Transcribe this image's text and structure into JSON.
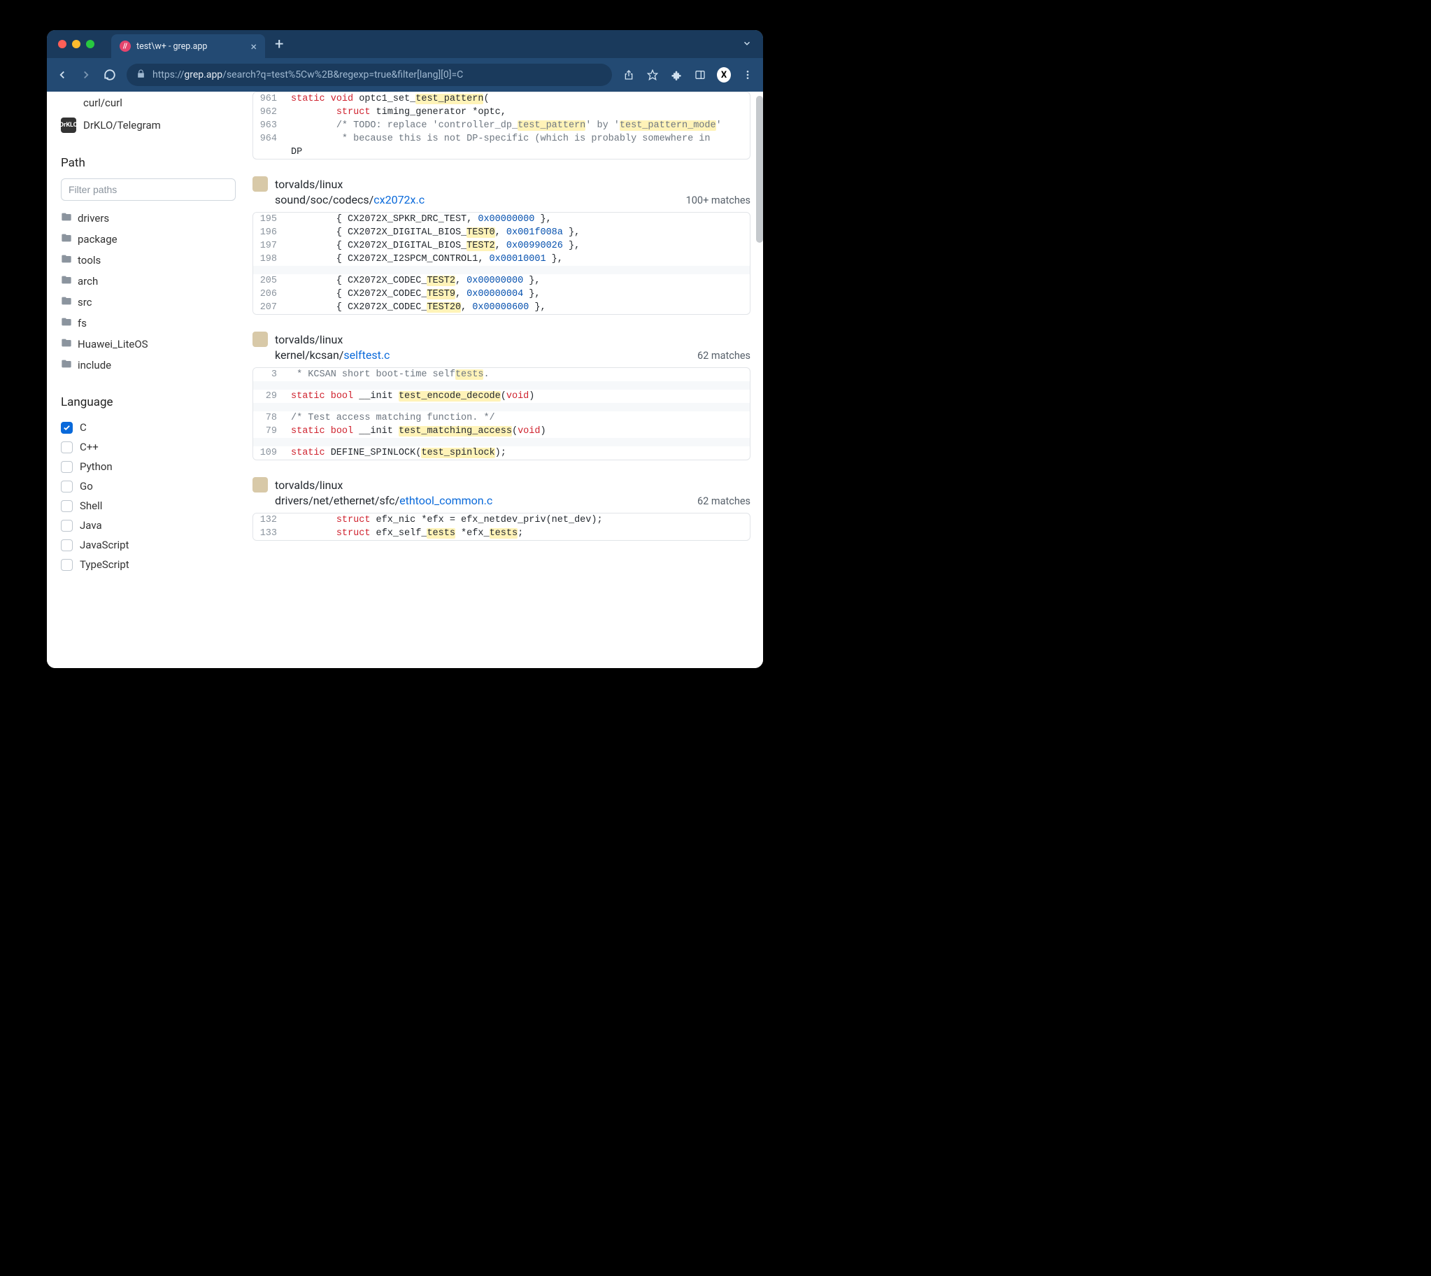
{
  "browser": {
    "tab_title": "test\\w+ - grep.app",
    "url_proto_host": "grep.app",
    "url_scheme": "https://",
    "url_path": "/search?q=test%5Cw%2B&regexp=true&filter[lang][0]=C"
  },
  "sidebar": {
    "repos": [
      {
        "name": "curl/curl",
        "avatar": ""
      },
      {
        "name": "DrKLO/Telegram",
        "avatar": "DrKLO"
      }
    ],
    "path_label": "Path",
    "path_placeholder": "Filter paths",
    "paths": [
      "drivers",
      "package",
      "tools",
      "arch",
      "src",
      "fs",
      "Huawei_LiteOS",
      "include"
    ],
    "lang_label": "Language",
    "languages": [
      {
        "name": "C",
        "checked": true
      },
      {
        "name": "C++",
        "checked": false
      },
      {
        "name": "Python",
        "checked": false
      },
      {
        "name": "Go",
        "checked": false
      },
      {
        "name": "Shell",
        "checked": false
      },
      {
        "name": "Java",
        "checked": false
      },
      {
        "name": "JavaScript",
        "checked": false
      },
      {
        "name": "TypeScript",
        "checked": false
      }
    ]
  },
  "results": [
    {
      "repo": "",
      "path_prefix": "",
      "path_link": "",
      "matches": "",
      "lines": [
        {
          "no": "961",
          "code": "<span class='kw'>static</span> <span class='kw'>void</span> optc1_set_<span class='hl'>test_pattern</span>("
        },
        {
          "no": "962",
          "code": "        <span class='kw'>struct</span> timing_generator *optc,"
        },
        {
          "no": "963",
          "code": "        <span class='com'>/* TODO: replace 'controller_dp_<span class='hl'>test_pattern</span>' by '<span class='hl'>test_pattern_mode</span>'</span>"
        },
        {
          "no": "964",
          "code": "        <span class='com'> * because this is not DP-specific (which is probably somewhere in</span>"
        }
      ],
      "cont": "DP"
    },
    {
      "repo": "torvalds/linux",
      "path_prefix": "sound/soc/codecs/",
      "path_link": "cx2072x.c",
      "matches": "100+ matches",
      "lines": [
        {
          "no": "195",
          "code": "        { CX2072X_SPKR_DRC_TEST, <span class='num'>0x00000000</span> },"
        },
        {
          "no": "196",
          "code": "        { CX2072X_DIGITAL_BIOS_<span class='hl'>TEST0</span>, <span class='num'>0x001f008a</span> },"
        },
        {
          "no": "197",
          "code": "        { CX2072X_DIGITAL_BIOS_<span class='hl'>TEST2</span>, <span class='num'>0x00990026</span> },"
        },
        {
          "no": "198",
          "code": "        { CX2072X_I2SPCM_CONTROL1, <span class='num'>0x00010001</span> },"
        }
      ],
      "lines2": [
        {
          "no": "205",
          "code": "        { CX2072X_CODEC_<span class='hl'>TEST2</span>, <span class='num'>0x00000000</span> },"
        },
        {
          "no": "206",
          "code": "        { CX2072X_CODEC_<span class='hl'>TEST9</span>, <span class='num'>0x00000004</span> },"
        },
        {
          "no": "207",
          "code": "        { CX2072X_CODEC_<span class='hl'>TEST20</span>, <span class='num'>0x00000600</span> },"
        }
      ]
    },
    {
      "repo": "torvalds/linux",
      "path_prefix": "kernel/kcsan/",
      "path_link": "selftest.c",
      "matches": "62 matches",
      "lines": [
        {
          "no": "3",
          "code": "<span class='com'> * KCSAN short boot-time self<span class='hl'>tests</span>.</span>"
        }
      ],
      "lines2": [
        {
          "no": "29",
          "code": "<span class='kw'>static</span> <span class='kw'>bool</span> __init <span class='hl'>test_encode_decode</span>(<span class='kw'>void</span>)"
        }
      ],
      "lines3": [
        {
          "no": "78",
          "code": "<span class='com'>/* Test access matching function. */</span>"
        },
        {
          "no": "79",
          "code": "<span class='kw'>static</span> <span class='kw'>bool</span> __init <span class='hl'>test_matching_access</span>(<span class='kw'>void</span>)"
        }
      ],
      "lines4": [
        {
          "no": "109",
          "code": "<span class='kw'>static</span> DEFINE_SPINLOCK(<span class='hl'>test_spinlock</span>);"
        }
      ]
    },
    {
      "repo": "torvalds/linux",
      "path_prefix": "drivers/net/ethernet/sfc/",
      "path_link": "ethtool_common.c",
      "matches": "62 matches",
      "lines": [
        {
          "no": "132",
          "code": "        <span class='kw'>struct</span> efx_nic *efx = efx_netdev_priv(net_dev);"
        },
        {
          "no": "133",
          "code": "        <span class='kw'>struct</span> efx_self_<span class='hl'>tests</span> *efx_<span class='hl'>tests</span>;"
        }
      ]
    }
  ]
}
